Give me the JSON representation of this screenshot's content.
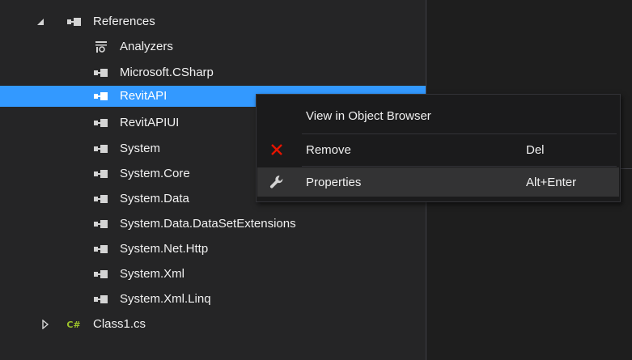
{
  "tree": {
    "references": {
      "label": "References",
      "expander": "expanded",
      "children": [
        {
          "label": "Analyzers",
          "icon": "analyzer-icon"
        },
        {
          "label": "Microsoft.CSharp",
          "icon": "reference-icon"
        },
        {
          "label": "RevitAPI",
          "icon": "reference-icon",
          "selected": true
        },
        {
          "label": "RevitAPIUI",
          "icon": "reference-icon"
        },
        {
          "label": "System",
          "icon": "reference-icon"
        },
        {
          "label": "System.Core",
          "icon": "reference-icon"
        },
        {
          "label": "System.Data",
          "icon": "reference-icon"
        },
        {
          "label": "System.Data.DataSetExtensions",
          "icon": "reference-icon"
        },
        {
          "label": "System.Net.Http",
          "icon": "reference-icon"
        },
        {
          "label": "System.Xml",
          "icon": "reference-icon"
        },
        {
          "label": "System.Xml.Linq",
          "icon": "reference-icon"
        }
      ]
    },
    "class_file": {
      "label": "Class1.cs",
      "icon_text": "C#",
      "expander": "collapsed"
    }
  },
  "context_menu": {
    "items": [
      {
        "label": "View in Object Browser",
        "shortcut": "",
        "icon": ""
      },
      {
        "label": "Remove",
        "shortcut": "Del",
        "icon": "remove-x-icon"
      },
      {
        "label": "Properties",
        "shortcut": "Alt+Enter",
        "icon": "wrench-icon",
        "highlighted": true
      }
    ]
  },
  "colors": {
    "background": "#252526",
    "selection": "#3399ff",
    "menu_background": "#1b1b1c",
    "remove_icon": "#e51400",
    "csharp_icon": "#9bc12b"
  }
}
